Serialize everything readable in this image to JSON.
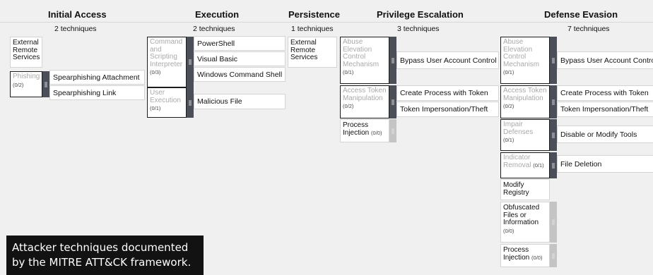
{
  "tactics": [
    {
      "name": "Initial Access",
      "count": "2 techniques"
    },
    {
      "name": "Execution",
      "count": "2 techniques"
    },
    {
      "name": "Persistence",
      "count": "1 techniques"
    },
    {
      "name": "Privilege Escalation",
      "count": "3 techniques"
    },
    {
      "name": "Defense Evasion",
      "count": "7 techniques"
    }
  ],
  "initial_access": {
    "external_remote": "External Remote Services",
    "phishing": "Phishing",
    "phishing_count": "(0/2)",
    "sub1": "Spearphishing Attachment",
    "sub2": "Spearphishing Link"
  },
  "execution": {
    "cmd": "Command and Scripting Interpreter",
    "cmd_count": "(0/3)",
    "powershell": "PowerShell",
    "vb": "Visual Basic",
    "wcs": "Windows Command Shell",
    "user_exec": "User Execution",
    "user_exec_count": "(0/1)",
    "malicious": "Malicious File"
  },
  "persistence": {
    "external_remote": "External Remote Services"
  },
  "privesc": {
    "abuse": "Abuse Elevation Control Mechanism",
    "abuse_count": "(0/1)",
    "bypass": "Bypass User Account Control",
    "atm": "Access Token Manipulation",
    "atm_count": "(0/2)",
    "create": "Create Process with Token",
    "imperson": "Token Impersonation/Theft",
    "pi": "Process Injection",
    "pi_count": "(0/0)"
  },
  "defense": {
    "abuse": "Abuse Elevation Control Mechanism",
    "abuse_count": "(0/1)",
    "bypass": "Bypass User Account Control",
    "atm": "Access Token Manipulation",
    "atm_count": "(0/2)",
    "create": "Create Process with Token",
    "imperson": "Token Impersonation/Theft",
    "impair": "Impair Defenses",
    "impair_count": "(0/1)",
    "disable": "Disable or Modify Tools",
    "indicator": "Indicator Removal",
    "indicator_count": "(0/1)",
    "filedel": "File Deletion",
    "modreg": "Modify Registry",
    "obf": "Obfuscated Files or Information",
    "obf_count": "(0/0)",
    "pi": "Process Injection",
    "pi_count": "(0/0)"
  },
  "caption": {
    "line1": "Attacker techniques documented",
    "line2": "by the MITRE ATT&CK framework."
  }
}
